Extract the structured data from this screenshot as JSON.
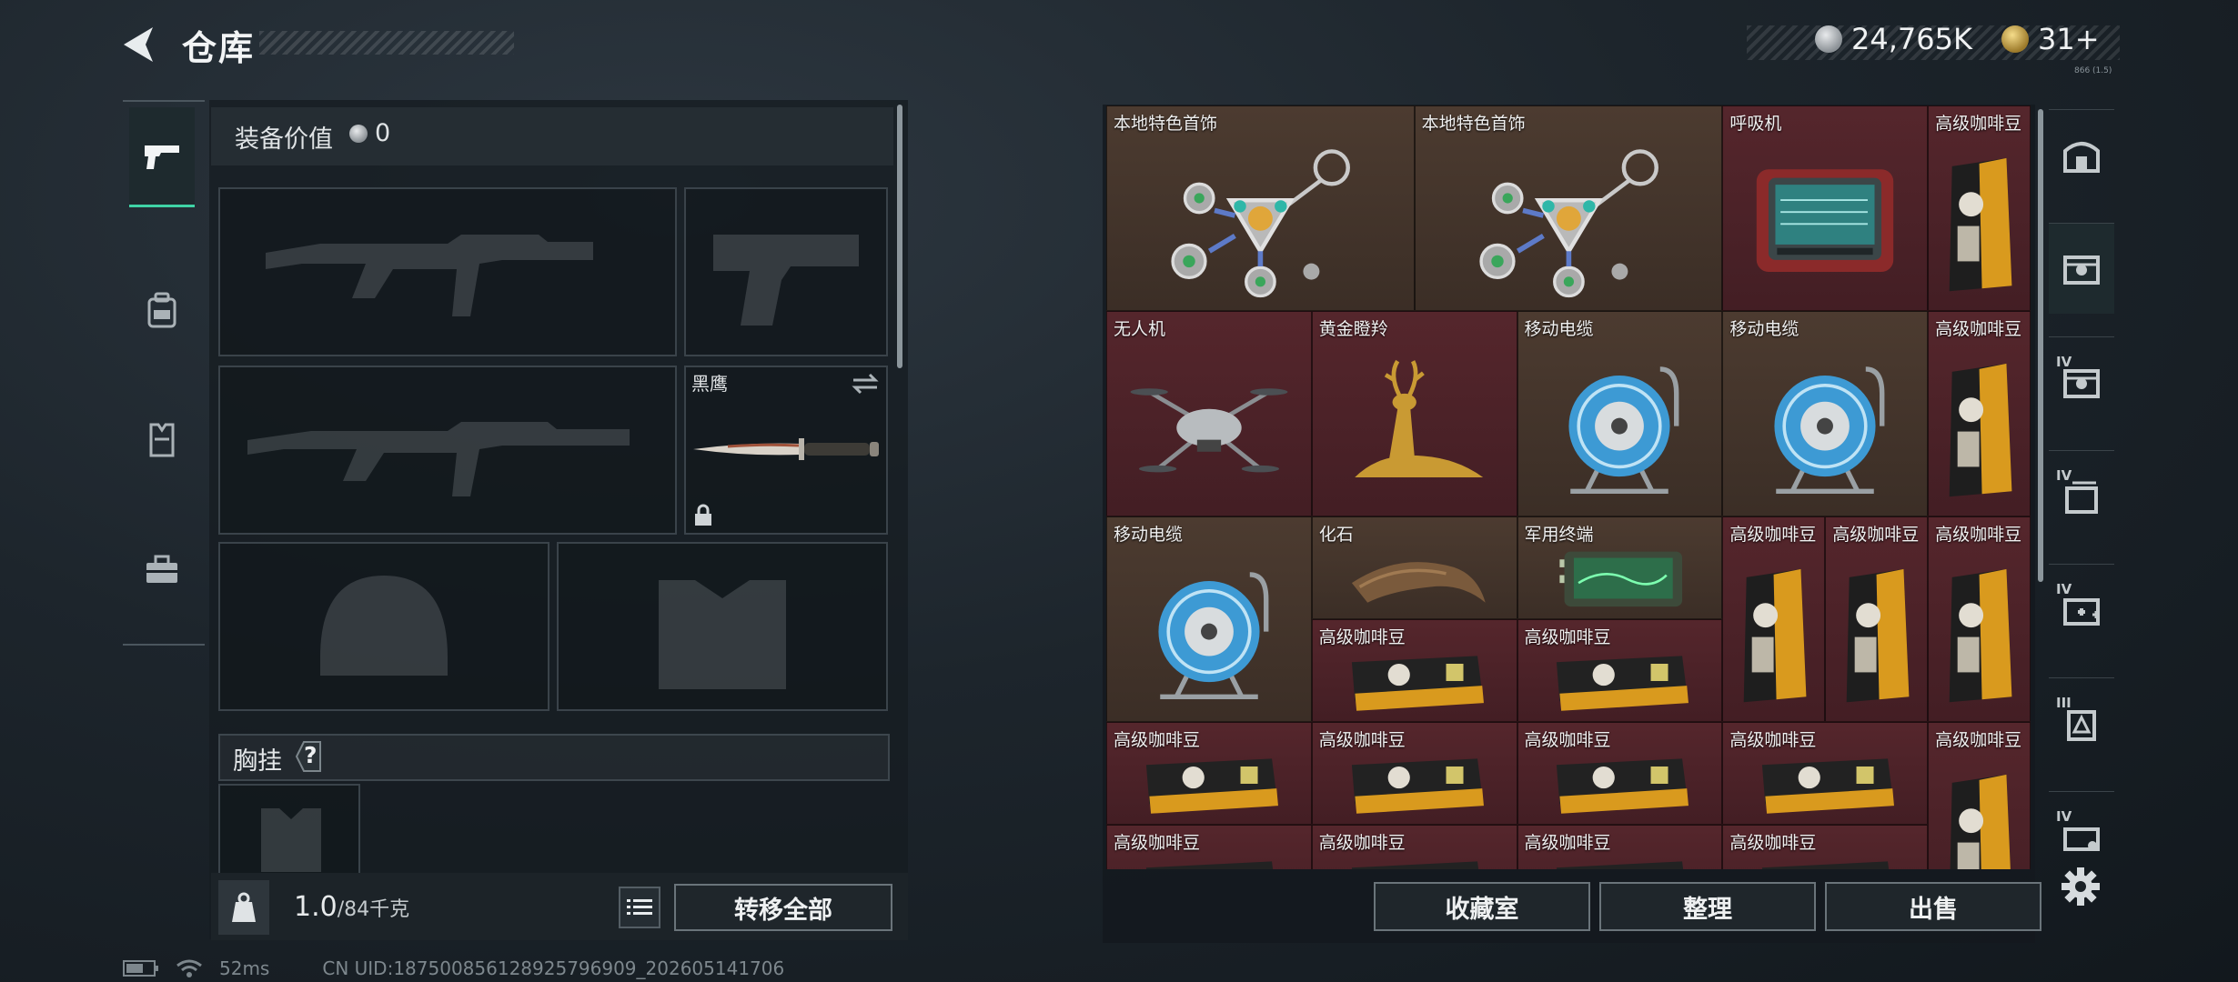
{
  "header": {
    "title": "仓库",
    "back_icon": "back-chevron-icon"
  },
  "currency": {
    "primary": {
      "value": "24,765K",
      "icon": "silver-coin-icon"
    },
    "secondary": {
      "value": "31+",
      "icon": "gold-coin-icon"
    },
    "small_note": "866 (1.5)"
  },
  "left_tabs": [
    {
      "icon": "pistol-icon",
      "selected": true
    },
    {
      "icon": "backpack-icon",
      "selected": false
    },
    {
      "icon": "vest-icon",
      "selected": false
    },
    {
      "icon": "toolbox-icon",
      "selected": false
    }
  ],
  "equipment": {
    "value_label": "装备价值",
    "value": "0",
    "knife_name": "黑鹰",
    "chest_label": "胸挂",
    "chest_help": "?"
  },
  "capacity": {
    "current": "1.0",
    "max": "/84千克"
  },
  "buttons": {
    "transfer_all": "转移全部",
    "vault": "收藏室",
    "sort": "整理",
    "sell": "出售"
  },
  "footer": {
    "ping": "52ms",
    "uid": "CN UID:18750085612892579690​9_202605141706"
  },
  "grid_items": [
    {
      "label": "本地特色首饰",
      "bg": "gold",
      "icon": "jewelry-icon",
      "col": 0,
      "row": 0,
      "w": 3,
      "h": 2
    },
    {
      "label": "本地特色首饰",
      "bg": "gold",
      "icon": "jewelry-icon",
      "col": 3,
      "row": 0,
      "w": 3,
      "h": 2
    },
    {
      "label": "呼吸机",
      "bg": "red",
      "icon": "ventilator-icon",
      "col": 6,
      "row": 0,
      "w": 2,
      "h": 2
    },
    {
      "label": "高级咖啡豆",
      "bg": "red",
      "icon": "coffee-bag-tall-icon",
      "col": 8,
      "row": 0,
      "w": 1,
      "h": 2
    },
    {
      "label": "无人机",
      "bg": "red",
      "icon": "drone-icon",
      "col": 0,
      "row": 2,
      "w": 2,
      "h": 2
    },
    {
      "label": "黄金瞪羚",
      "bg": "red",
      "icon": "golden-gazelle-icon",
      "col": 2,
      "row": 2,
      "w": 2,
      "h": 2
    },
    {
      "label": "移动电缆",
      "bg": "gold",
      "icon": "cable-reel-icon",
      "col": 4,
      "row": 2,
      "w": 2,
      "h": 2
    },
    {
      "label": "移动电缆",
      "bg": "gold",
      "icon": "cable-reel-icon",
      "col": 6,
      "row": 2,
      "w": 2,
      "h": 2
    },
    {
      "label": "高级咖啡豆",
      "bg": "red",
      "icon": "coffee-bag-tall-icon",
      "col": 8,
      "row": 2,
      "w": 1,
      "h": 2
    },
    {
      "label": "移动电缆",
      "bg": "gold",
      "icon": "cable-reel-icon",
      "col": 0,
      "row": 4,
      "w": 2,
      "h": 2
    },
    {
      "label": "化石",
      "bg": "gold",
      "icon": "fossil-claw-icon",
      "col": 2,
      "row": 4,
      "w": 2,
      "h": 1
    },
    {
      "label": "军用终端",
      "bg": "gold",
      "icon": "military-terminal-icon",
      "col": 4,
      "row": 4,
      "w": 2,
      "h": 1
    },
    {
      "label": "高级咖啡豆",
      "bg": "red",
      "icon": "coffee-bag-tall-icon",
      "col": 6,
      "row": 4,
      "w": 1,
      "h": 2
    },
    {
      "label": "高级咖啡豆",
      "bg": "red",
      "icon": "coffee-bag-tall-icon",
      "col": 7,
      "row": 4,
      "w": 1,
      "h": 2
    },
    {
      "label": "高级咖啡豆",
      "bg": "red",
      "icon": "coffee-bag-tall-icon",
      "col": 8,
      "row": 4,
      "w": 1,
      "h": 2
    },
    {
      "label": "高级咖啡豆",
      "bg": "red",
      "icon": "coffee-bag-flat-icon",
      "col": 2,
      "row": 5,
      "w": 2,
      "h": 1
    },
    {
      "label": "高级咖啡豆",
      "bg": "red",
      "icon": "coffee-bag-flat-icon",
      "col": 4,
      "row": 5,
      "w": 2,
      "h": 1
    },
    {
      "label": "高级咖啡豆",
      "bg": "red",
      "icon": "coffee-bag-flat-icon",
      "col": 0,
      "row": 6,
      "w": 2,
      "h": 1
    },
    {
      "label": "高级咖啡豆",
      "bg": "red",
      "icon": "coffee-bag-flat-icon",
      "col": 2,
      "row": 6,
      "w": 2,
      "h": 1
    },
    {
      "label": "高级咖啡豆",
      "bg": "red",
      "icon": "coffee-bag-flat-icon",
      "col": 4,
      "row": 6,
      "w": 2,
      "h": 1
    },
    {
      "label": "高级咖啡豆",
      "bg": "red",
      "icon": "coffee-bag-flat-icon",
      "col": 6,
      "row": 6,
      "w": 2,
      "h": 1
    },
    {
      "label": "高级咖啡豆",
      "bg": "red",
      "icon": "coffee-bag-tall-icon",
      "col": 8,
      "row": 6,
      "w": 1,
      "h": 2
    },
    {
      "label": "高级咖啡豆",
      "bg": "red",
      "icon": "coffee-bag-flat-icon",
      "col": 0,
      "row": 7,
      "w": 2,
      "h": 1
    },
    {
      "label": "高级咖啡豆",
      "bg": "red",
      "icon": "coffee-bag-flat-icon",
      "col": 2,
      "row": 7,
      "w": 2,
      "h": 1
    },
    {
      "label": "高级咖啡豆",
      "bg": "red",
      "icon": "coffee-bag-flat-icon",
      "col": 4,
      "row": 7,
      "w": 2,
      "h": 1
    },
    {
      "label": "高级咖啡豆",
      "bg": "red",
      "icon": "coffee-bag-flat-icon",
      "col": 6,
      "row": 7,
      "w": 2,
      "h": 1
    }
  ],
  "right_tabs": [
    {
      "icon": "bunker-icon",
      "badge": ""
    },
    {
      "icon": "storage-box-icon",
      "badge": ""
    },
    {
      "icon": "storage-box-icon",
      "badge": "IV"
    },
    {
      "icon": "folder-stack-icon",
      "badge": "IV"
    },
    {
      "icon": "medkit-box-icon",
      "badge": "IV"
    },
    {
      "icon": "backpack-case-icon",
      "badge": "III"
    },
    {
      "icon": "key-case-icon",
      "badge": "IV"
    }
  ],
  "colors": {
    "accent": "#3fd3a6",
    "cell_red": "#4d232a",
    "cell_gold": "#453529",
    "panel": "#1c2328"
  }
}
